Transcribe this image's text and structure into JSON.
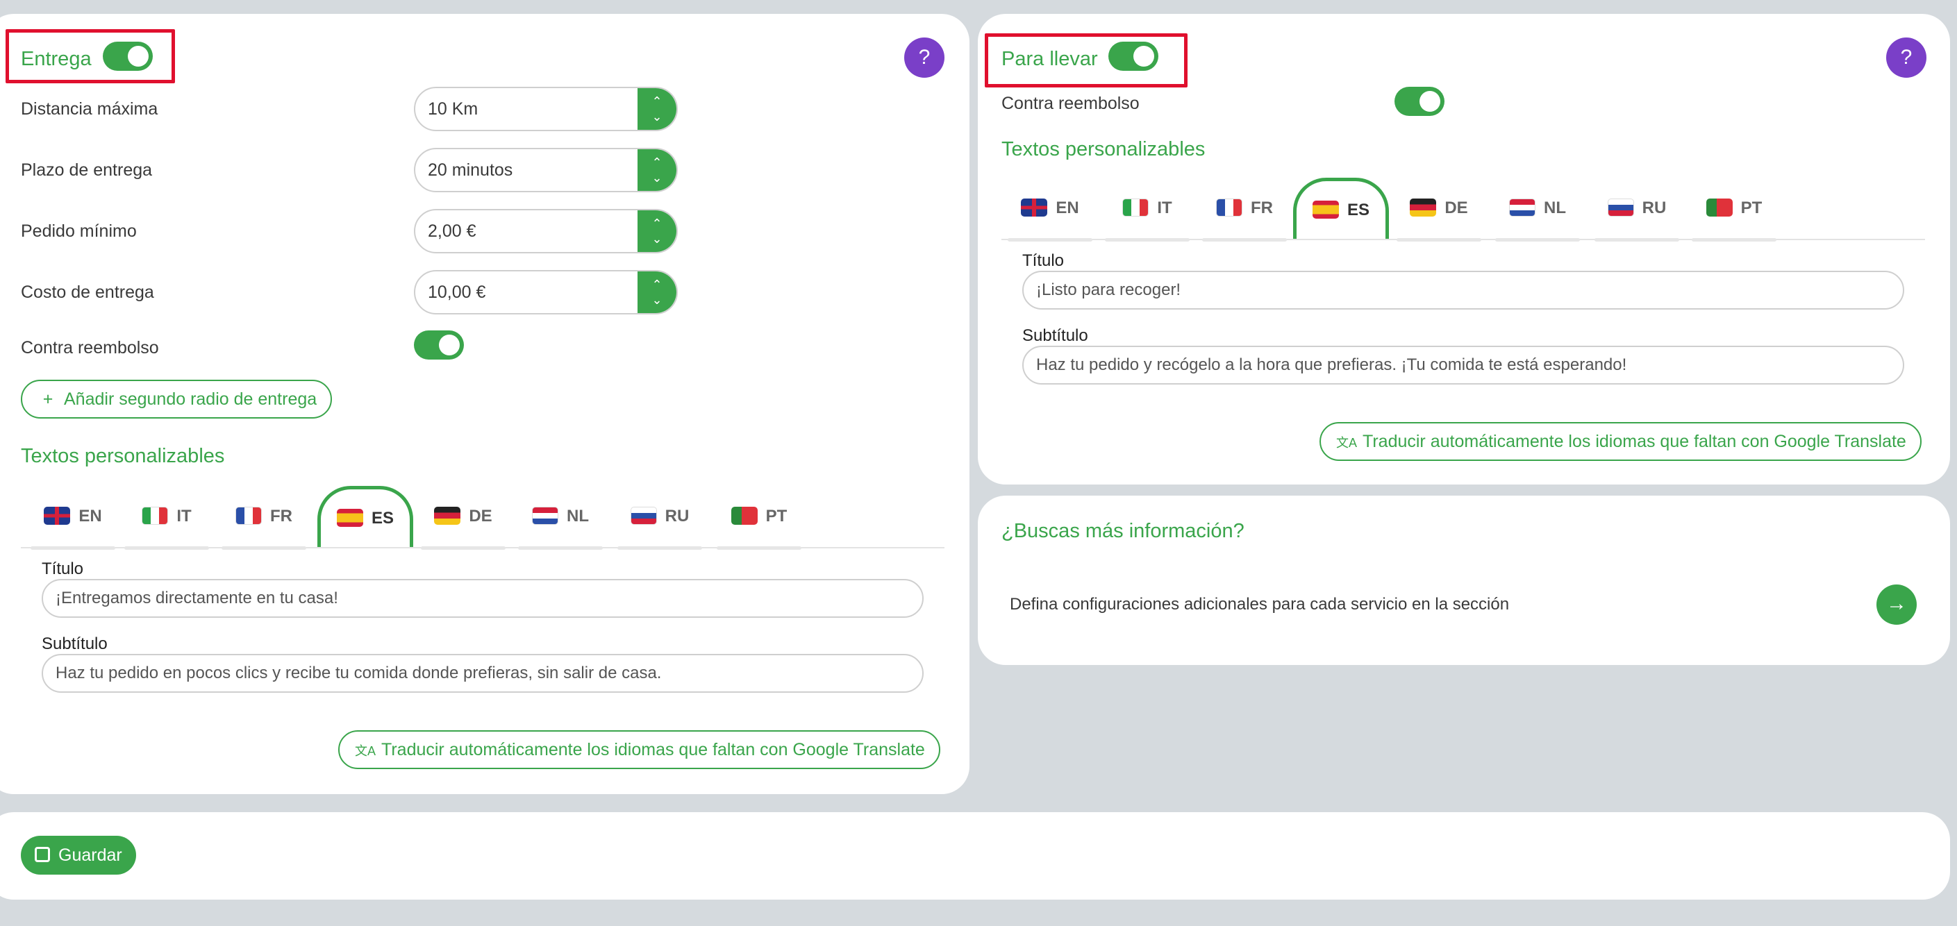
{
  "delivery": {
    "title": "Entrega",
    "help_icon": "?",
    "rows": [
      {
        "label": "Distancia máxima",
        "value": "10 Km"
      },
      {
        "label": "Plazo de entrega",
        "value": "20 minutos"
      },
      {
        "label": "Pedido mínimo",
        "value": "2,00 €"
      },
      {
        "label": "Costo de entrega",
        "value": "10,00 €"
      }
    ],
    "cod_label": "Contra reembolso",
    "add_radius_label": "Añadir segundo radio de entrega",
    "texts_title": "Textos personalizables",
    "tabs": [
      "EN",
      "IT",
      "FR",
      "ES",
      "DE",
      "NL",
      "RU",
      "PT"
    ],
    "active_tab": "ES",
    "title_label": "Título",
    "title_value": "¡Entregamos directamente en tu casa!",
    "subtitle_label": "Subtítulo",
    "subtitle_value": "Haz tu pedido en pocos clics y recibe tu comida donde prefieras, sin salir de casa.",
    "translate_label": "Traducir automáticamente los idiomas que faltan con Google Translate"
  },
  "takeaway": {
    "title": "Para llevar",
    "help_icon": "?",
    "cod_label": "Contra reembolso",
    "texts_title": "Textos personalizables",
    "tabs": [
      "EN",
      "IT",
      "FR",
      "ES",
      "DE",
      "NL",
      "RU",
      "PT"
    ],
    "active_tab": "ES",
    "title_label": "Título",
    "title_value": "¡Listo para recoger!",
    "subtitle_label": "Subtítulo",
    "subtitle_value": "Haz tu pedido y recógelo a la hora que prefieras. ¡Tu comida te está esperando!",
    "translate_label": "Traducir automáticamente los idiomas que faltan con Google Translate"
  },
  "info": {
    "title": "¿Buscas más información?",
    "text": "Defina configuraciones adicionales para cada servicio en la sección",
    "arrow_icon": "→"
  },
  "save": {
    "label": "Guardar"
  },
  "colors": {
    "accent": "#3aa54b",
    "help": "#7a3fc8",
    "highlight": "#e0102e"
  },
  "icons": {
    "plus": "+",
    "up": "⌃",
    "down": "⌄",
    "translate": "文A",
    "save": "💾"
  }
}
